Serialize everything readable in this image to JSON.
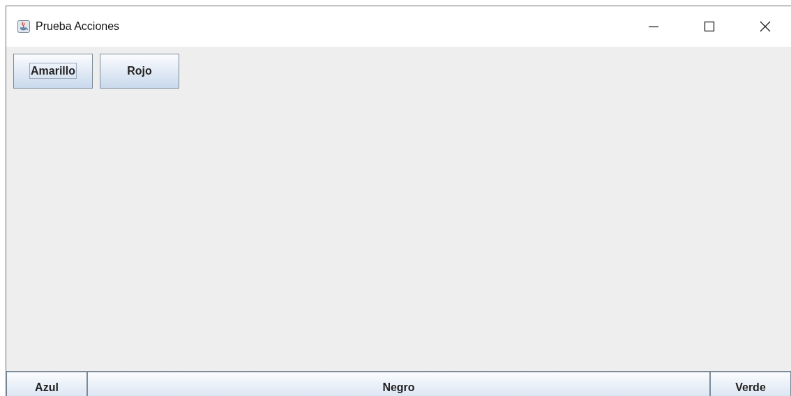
{
  "window": {
    "title": "Prueba Acciones"
  },
  "top_buttons": [
    {
      "label": "Amarillo",
      "focused": true
    },
    {
      "label": "Rojo",
      "focused": false
    }
  ],
  "bottom_buttons": [
    {
      "label": "Azul",
      "kind": "edge"
    },
    {
      "label": "Negro",
      "kind": "fill"
    },
    {
      "label": "Verde",
      "kind": "edge"
    }
  ]
}
